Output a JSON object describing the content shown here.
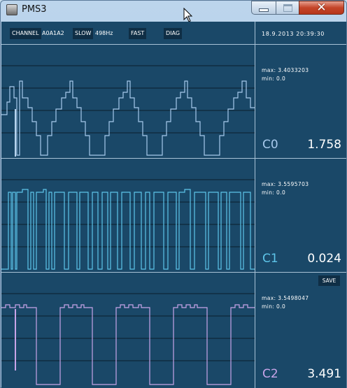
{
  "window": {
    "title": "PMS3",
    "close_glyph": "✕"
  },
  "toolbar": {
    "channel_label": "CHANNEL",
    "channels_value": "A0A1A2",
    "slow_label": "SLOW",
    "rate_value": "498Hz",
    "fast_label": "FAST",
    "diag_label": "DIAG"
  },
  "datetime": "18.9.2013 20:39:30",
  "channels": [
    {
      "name": "C0",
      "value": "1.758",
      "max": "max: 3.4033203",
      "min": "min: 0.0",
      "color": "#a7c9ec"
    },
    {
      "name": "C1",
      "value": "0.024",
      "max": "max: 3.5595703",
      "min": "min: 0.0",
      "color": "#5ec5e9"
    },
    {
      "name": "C2",
      "value": "3.491",
      "max": "max: 3.5498047",
      "min": "min: 0.0",
      "color": "#c8a4e8"
    }
  ],
  "save_label": "SAVE",
  "colors": {
    "background": "#1a4868",
    "button_bg": "#0f2e45",
    "divider": "#a8c2d6"
  },
  "icons": {
    "app": "app-icon",
    "minimize": "minimize-icon",
    "maximize": "maximize-icon",
    "close": "close-icon",
    "cursor": "mouse-cursor-icon"
  }
}
